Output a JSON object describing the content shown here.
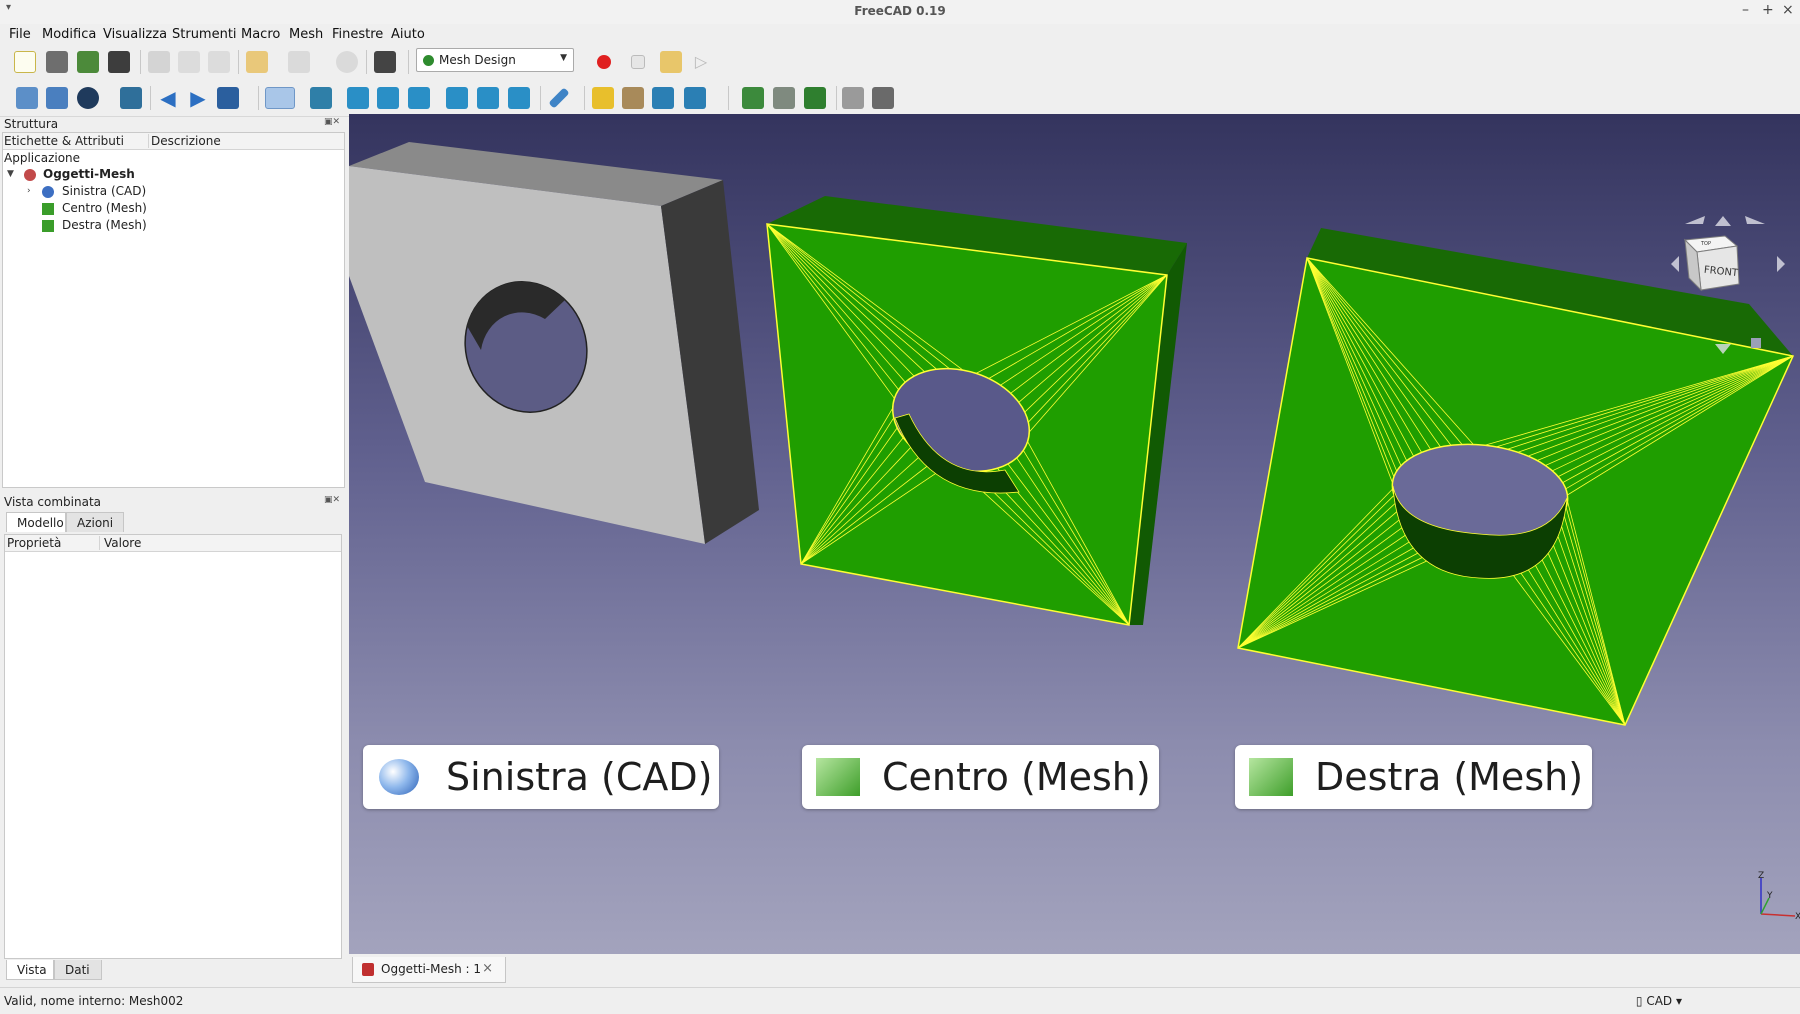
{
  "window": {
    "title": "FreeCAD 0.19",
    "sys_menu": "▾",
    "minimize": "–",
    "maximize": "+",
    "close": "×"
  },
  "menu": [
    "File",
    "Modifica",
    "Visualizza",
    "Strumenti",
    "Macro",
    "Mesh",
    "Finestre",
    "Aiuto"
  ],
  "workbench": {
    "selected": "Mesh Design"
  },
  "tree_panel": {
    "title": "Struttura",
    "columns": [
      "Etichette & Attributi",
      "Descrizione"
    ],
    "section": "Applicazione",
    "document": "Oggetti-Mesh",
    "items": [
      "Sinistra (CAD)",
      "Centro (Mesh)",
      "Destra (Mesh)"
    ]
  },
  "combo_panel": {
    "title": "Vista combinata",
    "tabs": [
      "Modello",
      "Azioni"
    ],
    "columns": [
      "Proprietà",
      "Valore"
    ],
    "bottom_tabs": [
      "Vista",
      "Dati"
    ]
  },
  "viewport": {
    "labels": [
      "Sinistra (CAD)",
      "Centro (Mesh)",
      "Destra (Mesh)"
    ],
    "navcube": {
      "face": "FRONT",
      "top": "TOP"
    },
    "axes": {
      "z": "Z",
      "y": "Y",
      "x": "X"
    },
    "colors": {
      "mesh_fill": "#1f9e00",
      "mesh_edges": "#ffff00",
      "cad_face": "#b9b9b9"
    }
  },
  "document_tab": {
    "label": "Oggetti-Mesh : 1",
    "close": "×"
  },
  "status": {
    "message": "Valid, nome interno: Mesh002",
    "nav_style": "CAD"
  }
}
